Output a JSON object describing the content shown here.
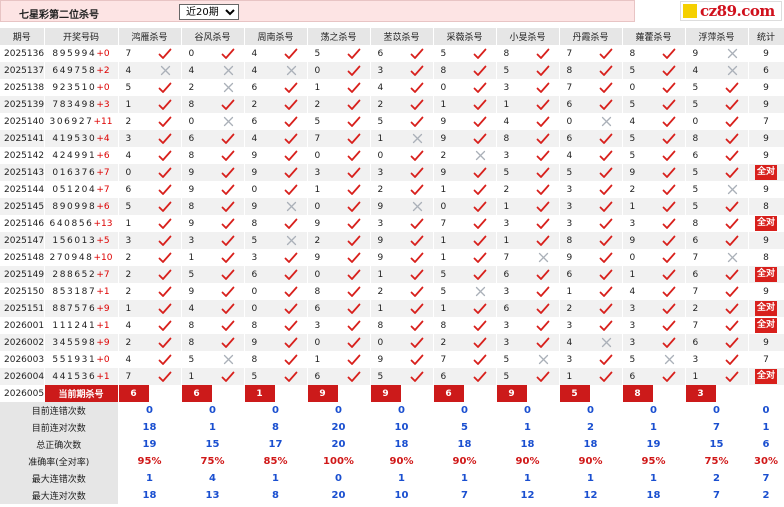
{
  "page": {
    "title": "七星彩第二位杀号",
    "period_selected": "近20期",
    "logo_text": "cz89.com"
  },
  "headers": [
    "期号",
    "开奖号码",
    "鸿雁杀号",
    "谷风杀号",
    "周南杀号",
    "荡之杀号",
    "苤苡杀号",
    "采薇杀号",
    "小旻杀号",
    "丹霞杀号",
    "蕹藿杀号",
    "浮萍杀号",
    "统计"
  ],
  "rows": [
    {
      "issue": "2025136",
      "digits": "895994",
      "plus": "+0",
      "cells": [
        [
          7,
          "c"
        ],
        [
          0,
          "c"
        ],
        [
          4,
          "c"
        ],
        [
          5,
          "c"
        ],
        [
          6,
          "c"
        ],
        [
          5,
          "c"
        ],
        [
          8,
          "c"
        ],
        [
          7,
          "c"
        ],
        [
          8,
          "c"
        ],
        [
          9,
          "x"
        ]
      ],
      "stat": "9"
    },
    {
      "issue": "2025137",
      "digits": "649758",
      "plus": "+2",
      "cells": [
        [
          4,
          "x"
        ],
        [
          4,
          "x"
        ],
        [
          4,
          "x"
        ],
        [
          0,
          "c"
        ],
        [
          3,
          "c"
        ],
        [
          8,
          "c"
        ],
        [
          5,
          "c"
        ],
        [
          8,
          "c"
        ],
        [
          5,
          "c"
        ],
        [
          4,
          "x"
        ]
      ],
      "stat": "6"
    },
    {
      "issue": "2025138",
      "digits": "923510",
      "plus": "+0",
      "cells": [
        [
          5,
          "c"
        ],
        [
          2,
          "x"
        ],
        [
          6,
          "c"
        ],
        [
          1,
          "c"
        ],
        [
          4,
          "c"
        ],
        [
          0,
          "c"
        ],
        [
          3,
          "c"
        ],
        [
          7,
          "c"
        ],
        [
          0,
          "c"
        ],
        [
          5,
          "c"
        ]
      ],
      "stat": "9"
    },
    {
      "issue": "2025139",
      "digits": "783498",
      "plus": "+3",
      "cells": [
        [
          1,
          "c"
        ],
        [
          8,
          "c"
        ],
        [
          2,
          "c"
        ],
        [
          2,
          "c"
        ],
        [
          2,
          "c"
        ],
        [
          1,
          "c"
        ],
        [
          1,
          "c"
        ],
        [
          6,
          "c"
        ],
        [
          5,
          "c"
        ],
        [
          5,
          "c"
        ]
      ],
      "stat": "9"
    },
    {
      "issue": "2025140",
      "digits": "306927",
      "plus": "+11",
      "cells": [
        [
          2,
          "c"
        ],
        [
          0,
          "x"
        ],
        [
          6,
          "c"
        ],
        [
          5,
          "c"
        ],
        [
          5,
          "c"
        ],
        [
          9,
          "c"
        ],
        [
          4,
          "c"
        ],
        [
          0,
          "x"
        ],
        [
          4,
          "c"
        ],
        [
          0,
          "c"
        ]
      ],
      "stat": "7"
    },
    {
      "issue": "2025141",
      "digits": "419530",
      "plus": "+4",
      "cells": [
        [
          3,
          "c"
        ],
        [
          6,
          "c"
        ],
        [
          4,
          "c"
        ],
        [
          7,
          "c"
        ],
        [
          1,
          "x"
        ],
        [
          9,
          "c"
        ],
        [
          8,
          "c"
        ],
        [
          6,
          "c"
        ],
        [
          5,
          "c"
        ],
        [
          8,
          "c"
        ]
      ],
      "stat": "9"
    },
    {
      "issue": "2025142",
      "digits": "424991",
      "plus": "+6",
      "cells": [
        [
          4,
          "c"
        ],
        [
          8,
          "c"
        ],
        [
          9,
          "c"
        ],
        [
          0,
          "c"
        ],
        [
          0,
          "c"
        ],
        [
          2,
          "x"
        ],
        [
          3,
          "c"
        ],
        [
          4,
          "c"
        ],
        [
          5,
          "c"
        ],
        [
          6,
          "c"
        ]
      ],
      "stat": "9"
    },
    {
      "issue": "2025143",
      "digits": "016376",
      "plus": "+7",
      "cells": [
        [
          0,
          "c"
        ],
        [
          9,
          "c"
        ],
        [
          9,
          "c"
        ],
        [
          3,
          "c"
        ],
        [
          3,
          "c"
        ],
        [
          9,
          "c"
        ],
        [
          5,
          "c"
        ],
        [
          5,
          "c"
        ],
        [
          9,
          "c"
        ],
        [
          5,
          "c"
        ]
      ],
      "stat": "全对"
    },
    {
      "issue": "2025144",
      "digits": "051204",
      "plus": "+7",
      "cells": [
        [
          6,
          "c"
        ],
        [
          9,
          "c"
        ],
        [
          0,
          "c"
        ],
        [
          1,
          "c"
        ],
        [
          2,
          "c"
        ],
        [
          1,
          "c"
        ],
        [
          2,
          "c"
        ],
        [
          3,
          "c"
        ],
        [
          2,
          "c"
        ],
        [
          5,
          "x"
        ]
      ],
      "stat": "9"
    },
    {
      "issue": "2025145",
      "digits": "890998",
      "plus": "+6",
      "cells": [
        [
          5,
          "c"
        ],
        [
          8,
          "c"
        ],
        [
          9,
          "x"
        ],
        [
          0,
          "c"
        ],
        [
          9,
          "x"
        ],
        [
          0,
          "c"
        ],
        [
          1,
          "c"
        ],
        [
          3,
          "c"
        ],
        [
          1,
          "c"
        ],
        [
          5,
          "c"
        ]
      ],
      "stat": "8"
    },
    {
      "issue": "2025146",
      "digits": "640856",
      "plus": "+13",
      "cells": [
        [
          1,
          "c"
        ],
        [
          9,
          "c"
        ],
        [
          8,
          "c"
        ],
        [
          9,
          "c"
        ],
        [
          3,
          "c"
        ],
        [
          7,
          "c"
        ],
        [
          3,
          "c"
        ],
        [
          3,
          "c"
        ],
        [
          3,
          "c"
        ],
        [
          8,
          "c"
        ]
      ],
      "stat": "全对"
    },
    {
      "issue": "2025147",
      "digits": "156013",
      "plus": "+5",
      "cells": [
        [
          3,
          "c"
        ],
        [
          3,
          "c"
        ],
        [
          5,
          "x"
        ],
        [
          2,
          "c"
        ],
        [
          9,
          "c"
        ],
        [
          1,
          "c"
        ],
        [
          1,
          "c"
        ],
        [
          8,
          "c"
        ],
        [
          9,
          "c"
        ],
        [
          6,
          "c"
        ]
      ],
      "stat": "9"
    },
    {
      "issue": "2025148",
      "digits": "270948",
      "plus": "+10",
      "cells": [
        [
          2,
          "c"
        ],
        [
          1,
          "c"
        ],
        [
          3,
          "c"
        ],
        [
          9,
          "c"
        ],
        [
          9,
          "c"
        ],
        [
          1,
          "c"
        ],
        [
          7,
          "x"
        ],
        [
          9,
          "c"
        ],
        [
          0,
          "c"
        ],
        [
          7,
          "x"
        ]
      ],
      "stat": "8"
    },
    {
      "issue": "2025149",
      "digits": "288652",
      "plus": "+7",
      "cells": [
        [
          2,
          "c"
        ],
        [
          5,
          "c"
        ],
        [
          6,
          "c"
        ],
        [
          0,
          "c"
        ],
        [
          1,
          "c"
        ],
        [
          5,
          "c"
        ],
        [
          6,
          "c"
        ],
        [
          6,
          "c"
        ],
        [
          1,
          "c"
        ],
        [
          6,
          "c"
        ]
      ],
      "stat": "全对"
    },
    {
      "issue": "2025150",
      "digits": "853187",
      "plus": "+1",
      "cells": [
        [
          2,
          "c"
        ],
        [
          9,
          "c"
        ],
        [
          0,
          "c"
        ],
        [
          8,
          "c"
        ],
        [
          2,
          "c"
        ],
        [
          5,
          "x"
        ],
        [
          3,
          "c"
        ],
        [
          1,
          "c"
        ],
        [
          4,
          "c"
        ],
        [
          7,
          "c"
        ]
      ],
      "stat": "9"
    },
    {
      "issue": "2025151",
      "digits": "887576",
      "plus": "+9",
      "cells": [
        [
          1,
          "c"
        ],
        [
          4,
          "c"
        ],
        [
          0,
          "c"
        ],
        [
          6,
          "c"
        ],
        [
          1,
          "c"
        ],
        [
          1,
          "c"
        ],
        [
          6,
          "c"
        ],
        [
          2,
          "c"
        ],
        [
          3,
          "c"
        ],
        [
          2,
          "c"
        ]
      ],
      "stat": "全对"
    },
    {
      "issue": "2026001",
      "digits": "111241",
      "plus": "+1",
      "cells": [
        [
          4,
          "c"
        ],
        [
          8,
          "c"
        ],
        [
          8,
          "c"
        ],
        [
          3,
          "c"
        ],
        [
          8,
          "c"
        ],
        [
          8,
          "c"
        ],
        [
          3,
          "c"
        ],
        [
          3,
          "c"
        ],
        [
          3,
          "c"
        ],
        [
          7,
          "c"
        ]
      ],
      "stat": "全对"
    },
    {
      "issue": "2026002",
      "digits": "345598",
      "plus": "+9",
      "cells": [
        [
          2,
          "c"
        ],
        [
          8,
          "c"
        ],
        [
          9,
          "c"
        ],
        [
          0,
          "c"
        ],
        [
          0,
          "c"
        ],
        [
          2,
          "c"
        ],
        [
          3,
          "c"
        ],
        [
          4,
          "x"
        ],
        [
          3,
          "c"
        ],
        [
          6,
          "c"
        ]
      ],
      "stat": "9"
    },
    {
      "issue": "2026003",
      "digits": "551931",
      "plus": "+0",
      "cells": [
        [
          4,
          "c"
        ],
        [
          5,
          "x"
        ],
        [
          8,
          "c"
        ],
        [
          1,
          "c"
        ],
        [
          9,
          "c"
        ],
        [
          7,
          "c"
        ],
        [
          5,
          "x"
        ],
        [
          3,
          "c"
        ],
        [
          5,
          "x"
        ],
        [
          3,
          "c"
        ]
      ],
      "stat": "7"
    },
    {
      "issue": "2026004",
      "digits": "441536",
      "plus": "+1",
      "cells": [
        [
          7,
          "c"
        ],
        [
          1,
          "c"
        ],
        [
          5,
          "c"
        ],
        [
          6,
          "c"
        ],
        [
          5,
          "c"
        ],
        [
          6,
          "c"
        ],
        [
          5,
          "c"
        ],
        [
          1,
          "c"
        ],
        [
          6,
          "c"
        ],
        [
          1,
          "c"
        ]
      ],
      "stat": "全对"
    }
  ],
  "current": {
    "issue": "2026005",
    "label": "当前期杀号",
    "values": [
      "6",
      "6",
      "1",
      "9",
      "9",
      "6",
      "9",
      "5",
      "8",
      "3"
    ]
  },
  "stats": [
    {
      "label": "目前连错次数",
      "values": [
        "0",
        "0",
        "0",
        "0",
        "0",
        "0",
        "0",
        "0",
        "0",
        "0",
        "0"
      ],
      "red": false
    },
    {
      "label": "目前连对次数",
      "values": [
        "18",
        "1",
        "8",
        "20",
        "10",
        "5",
        "1",
        "2",
        "1",
        "7",
        "1"
      ],
      "red": false
    },
    {
      "label": "总正确次数",
      "values": [
        "19",
        "15",
        "17",
        "20",
        "18",
        "18",
        "18",
        "18",
        "19",
        "15",
        "6"
      ],
      "red": false
    },
    {
      "label": "准确率(全对率)",
      "values": [
        "95%",
        "75%",
        "85%",
        "100%",
        "90%",
        "90%",
        "90%",
        "90%",
        "95%",
        "75%",
        "30%"
      ],
      "red": true
    },
    {
      "label": "最大连错次数",
      "values": [
        "1",
        "4",
        "1",
        "0",
        "1",
        "1",
        "1",
        "1",
        "1",
        "2",
        "7"
      ],
      "red": false
    },
    {
      "label": "最大连对次数",
      "values": [
        "18",
        "13",
        "8",
        "20",
        "10",
        "7",
        "12",
        "12",
        "18",
        "7",
        "2"
      ],
      "red": false
    }
  ],
  "colors": {
    "correct": "#d8201c",
    "wrong": "#aab0b8",
    "badge": "#d8201c",
    "stat_blue": "#1a4fd0",
    "header": "#e6e6e6"
  },
  "icons": {
    "correct": "check-icon",
    "wrong": "cross-icon"
  }
}
